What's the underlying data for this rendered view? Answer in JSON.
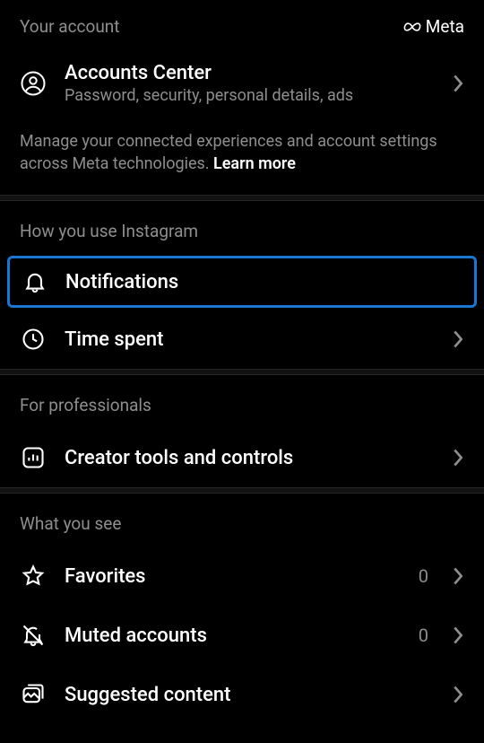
{
  "account_section": {
    "header": "Your account",
    "brand": "Meta",
    "accounts_center": {
      "title": "Accounts Center",
      "subtitle": "Password, security, personal details, ads"
    },
    "description": "Manage your connected experiences and account settings across Meta technologies.",
    "learn_more": "Learn more"
  },
  "how_you_use": {
    "header": "How you use Instagram",
    "items": [
      {
        "label": "Notifications",
        "icon": "bell-icon",
        "highlighted": true
      },
      {
        "label": "Time spent",
        "icon": "clock-icon"
      }
    ]
  },
  "professionals": {
    "header": "For professionals",
    "items": [
      {
        "label": "Creator tools and controls",
        "icon": "chart-box-icon"
      }
    ]
  },
  "what_you_see": {
    "header": "What you see",
    "items": [
      {
        "label": "Favorites",
        "icon": "star-icon",
        "count": "0"
      },
      {
        "label": "Muted accounts",
        "icon": "bell-off-icon",
        "count": "0"
      },
      {
        "label": "Suggested content",
        "icon": "image-stack-icon"
      }
    ]
  }
}
